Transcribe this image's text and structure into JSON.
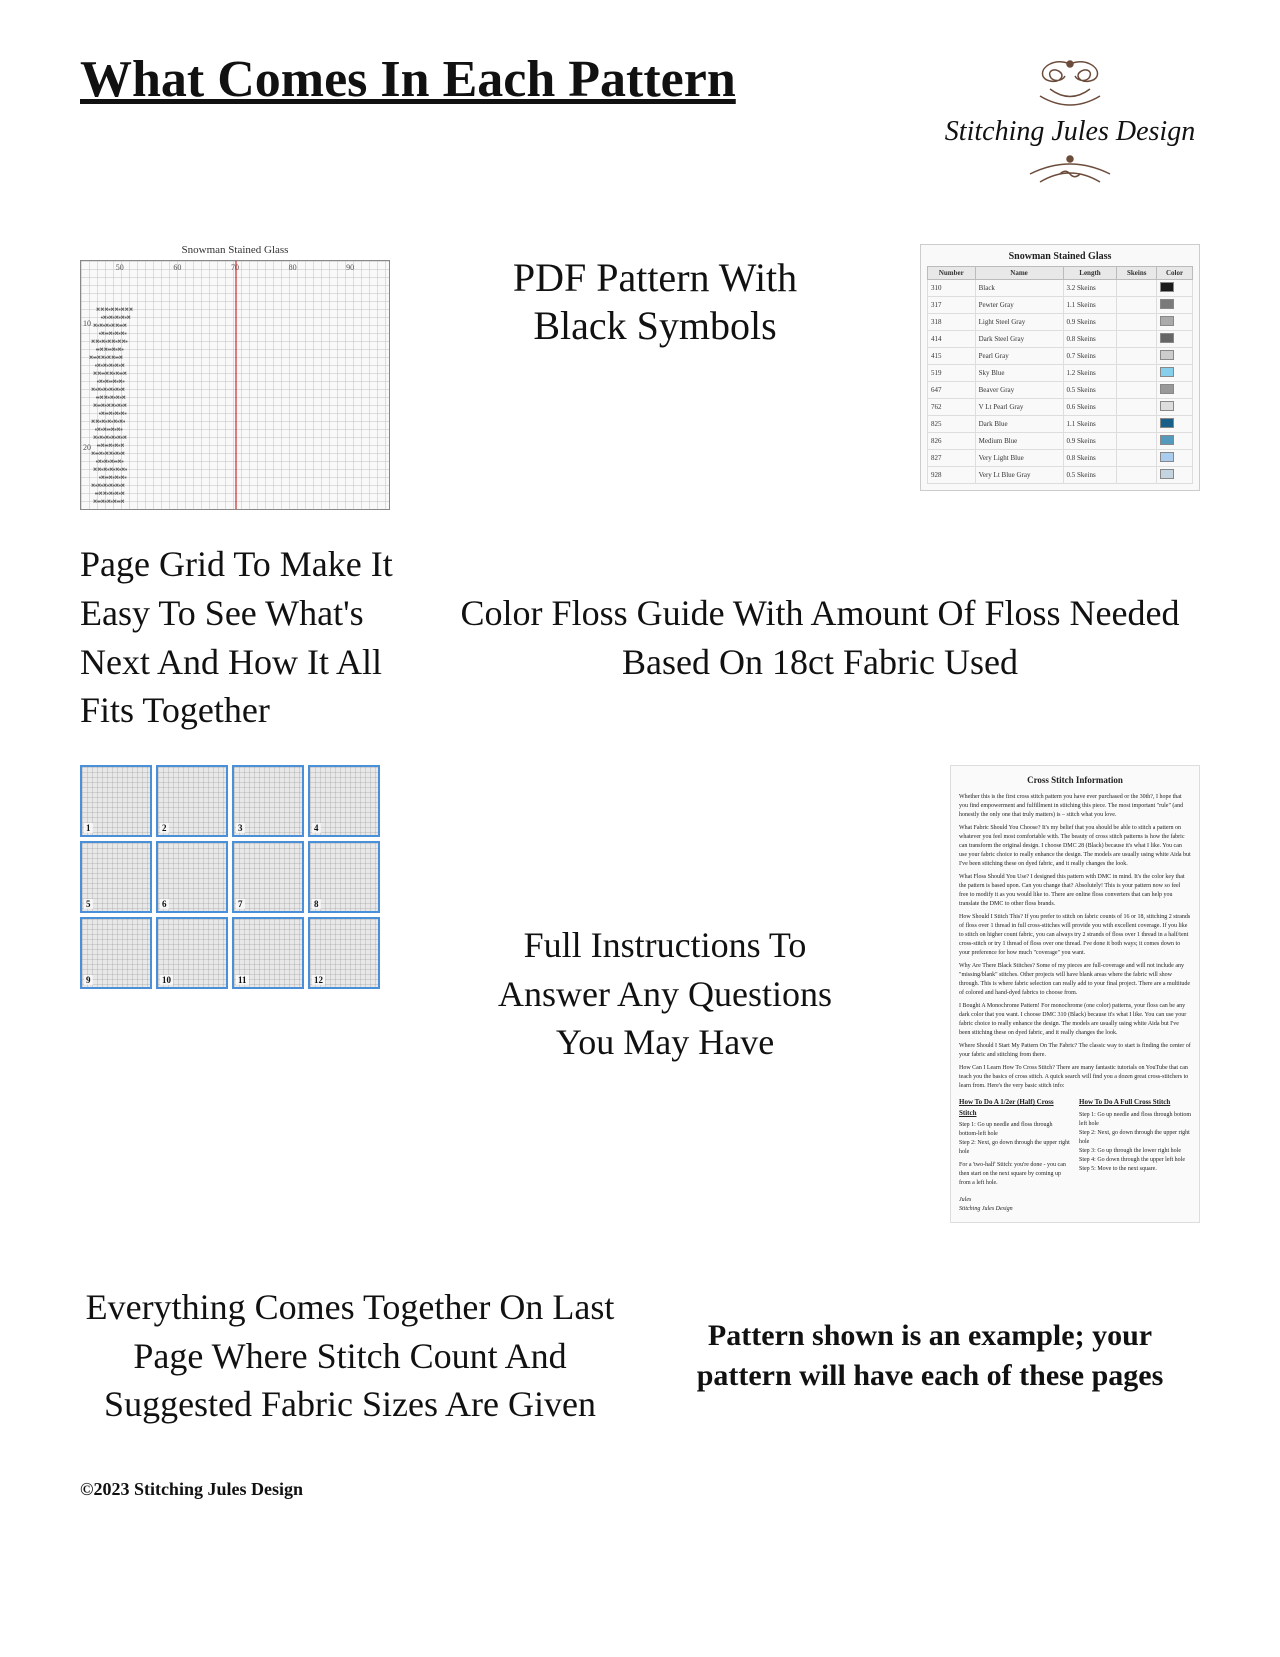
{
  "header": {
    "title": "What Comes In Each Pattern",
    "logo": {
      "line1": "Stitching Jules Design",
      "ornament": "✾"
    }
  },
  "section1": {
    "pattern_label": "Snowman Stained Glass",
    "pdf_text_line1": "PDF Pattern With",
    "pdf_text_line2": "Black Symbols",
    "floss_table": {
      "title": "Snowman Stained Glass",
      "headers": [
        "Number",
        "Name",
        "Length",
        "Skeins"
      ],
      "rows": [
        [
          "310",
          "Black",
          "3.2 Skeins",
          ""
        ],
        [
          "317",
          "Pewter Gray",
          "1.1 Skeins",
          ""
        ],
        [
          "318",
          "Light Steel Gray",
          "0.9 Skeins",
          ""
        ],
        [
          "414",
          "Dark Steel Gray",
          "0.8 Skeins",
          ""
        ],
        [
          "415",
          "Pearl Gray",
          "0.7 Skeins",
          ""
        ],
        [
          "519",
          "Sky Blue",
          "1.2 Skeins",
          ""
        ],
        [
          "647",
          "Beaver Gray",
          "0.5 Skeins",
          ""
        ],
        [
          "762",
          "V Lt Pearl Gray",
          "0.6 Skeins",
          ""
        ],
        [
          "825",
          "Dark Blue",
          "1.1 Skeins",
          ""
        ],
        [
          "826",
          "Medium Blue",
          "0.9 Skeins",
          ""
        ],
        [
          "827",
          "Very Light Blue",
          "0.8 Skeins",
          ""
        ],
        [
          "928",
          "Very Lt Blue Gray",
          "0.5 Skeins",
          ""
        ]
      ],
      "swatches": [
        "#1a1a1a",
        "#7a7a7a",
        "#aaaaaa",
        "#666666",
        "#cccccc",
        "#87ceeb",
        "#999999",
        "#dddddd",
        "#1a5f8a",
        "#5599bb",
        "#aaccee",
        "#c5d5e0"
      ]
    }
  },
  "section2": {
    "page_grid_text": "Page Grid To Make It Easy To See What's Next And How It All Fits Together",
    "color_floss_text": "Color Floss Guide With Amount Of Floss Needed Based On 18ct Fabric Used"
  },
  "section3": {
    "thumbnails": [
      {
        "number": "1"
      },
      {
        "number": "2"
      },
      {
        "number": "3"
      },
      {
        "number": "4"
      },
      {
        "number": "5"
      },
      {
        "number": "6"
      },
      {
        "number": "7"
      },
      {
        "number": "8"
      },
      {
        "number": "9"
      },
      {
        "number": "10"
      },
      {
        "number": "11"
      },
      {
        "number": "12"
      }
    ],
    "instructions_text_line1": "Full Instructions To",
    "instructions_text_line2": "Answer Any Questions",
    "instructions_text_line3": "You May Have",
    "info_title": "Cross Stitch Information",
    "info_paragraphs": [
      "Whether this is the first cross stitch pattern you have ever purchased or the 30th?, I hope that you find empowerment and fulfillment in stitching this piece. The most important \"rule\" (and honestly the only one that truly matters) is – stitch what you love.",
      "What Fabric Should You Choose? It's my belief that you should be able to stitch a pattern on whatever you feel most comfortable with. The beauty of cross stitch patterns is how the fabric can transform the original design. I choose DMC 28 (Black) because it's what I like. You can use your fabric choice to really enhance the design. The models are usually using white Aida but I've been stitching these on dyed fabric, and it really changes the look.",
      "What Floss Should You Use? I designed this pattern with DMC in mind. It's the color key that the pattern is based upon. Can you change that? Absolutely! This is your pattern now so feel free to modify it as you would like to. There are online floss converters that can help you translate the DMC to other floss brands.",
      "How Should I Stitch This? If you prefer to stitch on fabric counts of 16 or 18, stitching 2 strands of floss over 1 thread in full cross-stitches will provide you with excellent coverage. If you like to stitch on higher count fabric, you can always try 2 strands of floss over 1 thread in a half/tent cross-stitch or try 1 thread of floss over one thread. I've done it both ways; it comes down to your preference for how much \"coverage\" you want.",
      "Why Are There Black Stitches? Some of my pieces are full-coverage and will not include any \"missing/blank\" stitches. Other projects will have blank areas where the fabric will show through. This is where fabric selection can really add to your final project. There are a multitude of colored and hand-dyed fabrics to choose from.",
      "I Bought A Monochrome Pattern! For monochrome (one color) patterns, your floss can be any dark color that you want. I choose DMC 310 (Black) because it's what I like. You can use your fabric choice to really enhance the design. The models are usually using white Aida but I've been stitching these on dyed fabric, and it really changes the look.",
      "Where Should I Start My Pattern On The Fabric? The classic way to start is finding the center of your fabric and stitching from there.",
      "How Can I Learn How To Cross Stitch? There are many fantastic tutorials on YouTube that can teach you the basics of cross stitch. A quick search will find you a dozen great cross-stitchers to learn from. Here's the very basic stitch info:"
    ],
    "how_to_half_title": "How To Do A 1/2er (Half) Cross Stitch",
    "how_to_half_steps": [
      "Step 1: Go up needle and floss through bottom-left hole",
      "Step 2: Next, go down through the upper right hole"
    ],
    "how_to_half_extra": "For a 'two-half' Stitch: you're done - you can then start on the next square by coming up from a left hole.",
    "how_to_full_title": "How To Do A Full Cross Stitch",
    "how_to_full_steps": [
      "Step 1: Go up needle and floss through bottom left hole",
      "Step 2: Next, go down through the upper right hole",
      "Step 3: Go up through the lower right hole",
      "Step 4: Go down through the upper left hole",
      "Step 5: Move to the next square."
    ],
    "signature_name": "Jules",
    "signature_company": "Stitching Jules Design"
  },
  "section4": {
    "everything_text": "Everything Comes Together On Last Page Where Stitch Count And Suggested Fabric Sizes Are Given",
    "example_text": "Pattern shown is an example; your pattern will have each of these pages"
  },
  "footer": {
    "copyright": "©2023 Stitching Jules Design"
  }
}
